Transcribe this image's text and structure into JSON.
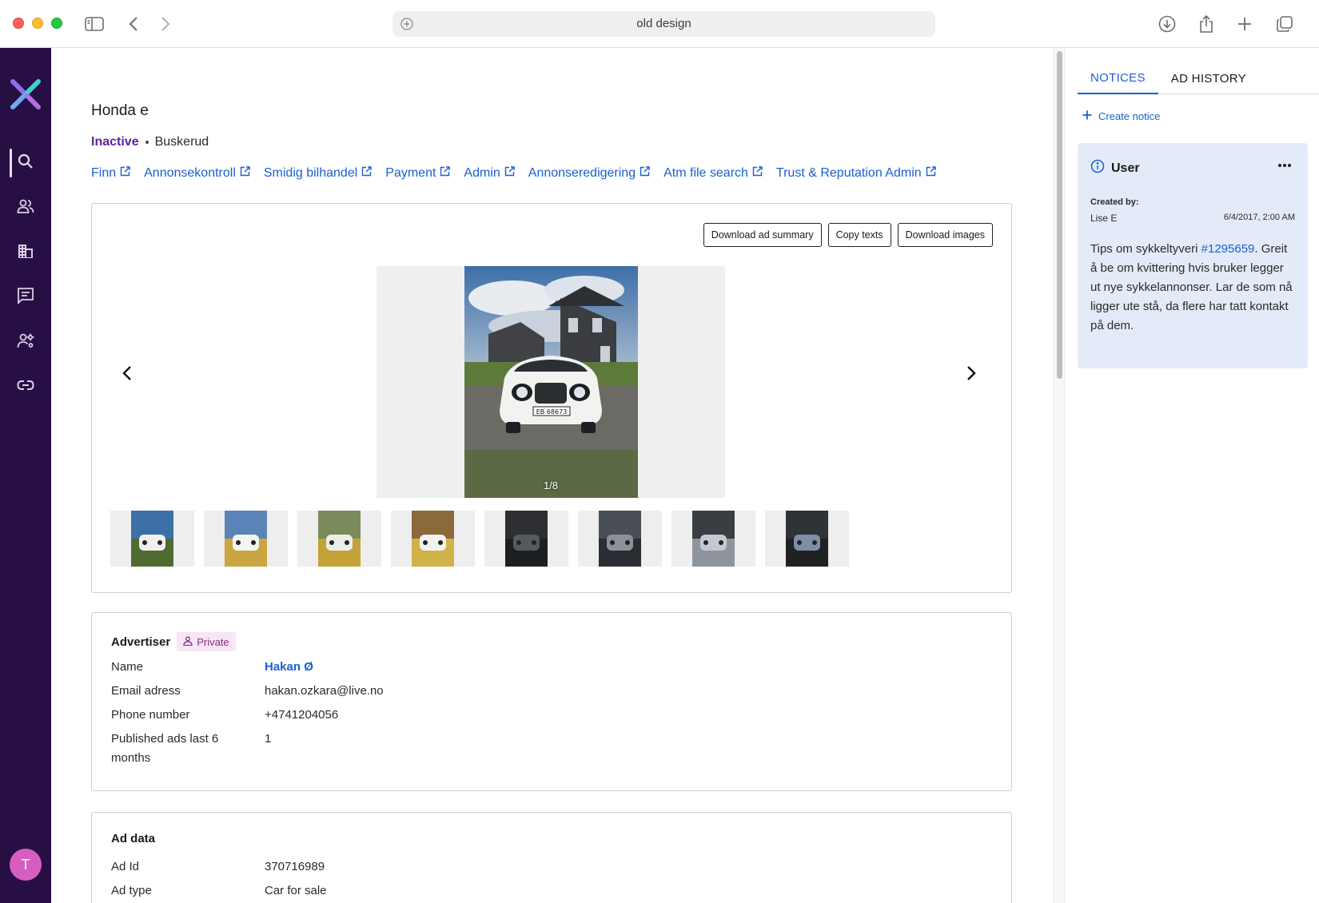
{
  "browser": {
    "url_text": "old design"
  },
  "user": {
    "avatar_initial": "T"
  },
  "ad": {
    "title": "Honda e",
    "status": "Inactive",
    "region": "Buskerud",
    "links": [
      "Finn",
      "Annonsekontroll",
      "Smidig bilhandel",
      "Payment",
      "Admin",
      "Annonseredigering",
      "Atm file search",
      "Trust & Reputation Admin"
    ]
  },
  "gallery": {
    "buttons": {
      "download_summary": "Download ad summary",
      "copy_texts": "Copy texts",
      "download_images": "Download images"
    },
    "counter": "1/8",
    "thumbnail_count": 8
  },
  "advertiser": {
    "heading": "Advertiser",
    "badge": "Private",
    "rows": [
      {
        "label": "Name",
        "value": "Hakan Ø"
      },
      {
        "label": "Email adress",
        "value": "hakan.ozkara@live.no"
      },
      {
        "label": "Phone number",
        "value": "+4741204056"
      },
      {
        "label": "Published ads last 6 months",
        "value": "1"
      }
    ]
  },
  "ad_data": {
    "heading": "Ad data",
    "rows": [
      {
        "label": "Ad Id",
        "value": "370716989"
      },
      {
        "label": "Ad type",
        "value": "Car for sale"
      }
    ]
  },
  "notices_panel": {
    "tabs": [
      "NOTICES",
      "AD HISTORY"
    ],
    "create_label": "Create notice",
    "notice": {
      "type": "User",
      "created_by_label": "Created by:",
      "created_by": "Lise E",
      "date": "6/4/2017, 2:00 AM",
      "text_before": "Tips om sykkeltyveri ",
      "reference": "#1295659",
      "text_after": ". Greit å be om kvittering hvis bruker legger ut nye sykkelannonser. Lar de som nå ligger ute stå, da flere har tatt kontakt på dem."
    }
  },
  "colors": {
    "nav_bg": "#270f44",
    "accent_link": "#1b5fd0",
    "inactive_status": "#5b1f9e",
    "notice_bg": "#e3ebf8",
    "private_badge_bg": "#f6e6f6"
  }
}
